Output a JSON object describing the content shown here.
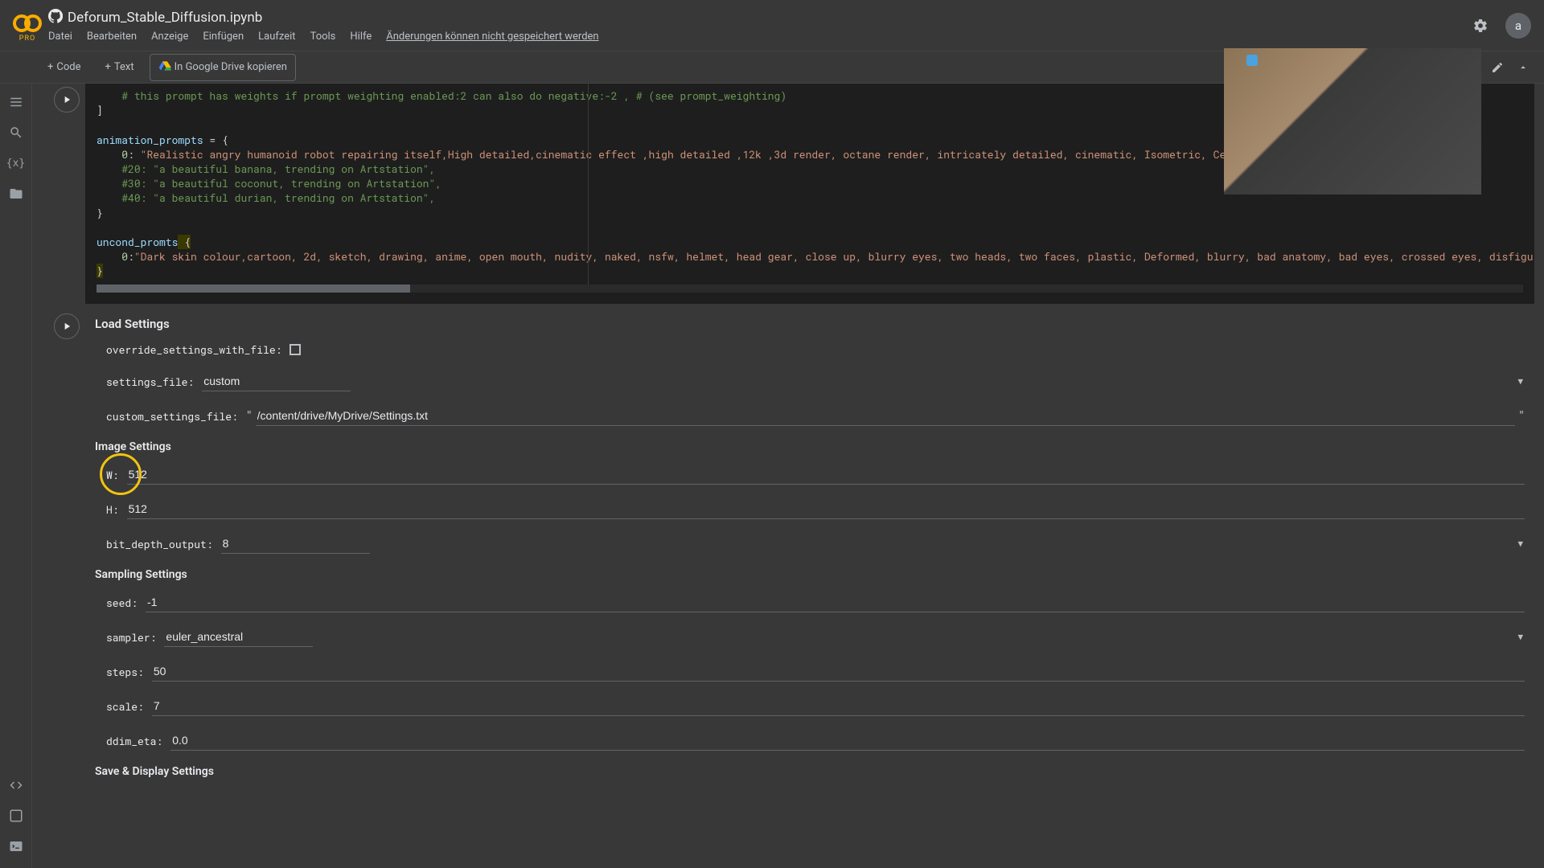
{
  "header": {
    "title": "Deforum_Stable_Diffusion.ipynb",
    "pro": "PRO",
    "menus": [
      "Datei",
      "Bearbeiten",
      "Anzeige",
      "Einfügen",
      "Laufzeit",
      "Tools",
      "Hilfe"
    ],
    "warning": "Änderungen können nicht gespeichert werden",
    "avatar": "a"
  },
  "toolbar": {
    "code": "Code",
    "text": "Text",
    "drive": "In Google Drive kopieren"
  },
  "code": {
    "line1_comment": "# this prompt has weights if prompt weighting enabled:2 can also do negative:-2 , # (see prompt_weighting)",
    "line2_close": "]",
    "anim_var": "animation_prompts",
    "anim_eq": " = {",
    "anim_key0": "0",
    "anim_val0": "\"Realistic angry humanoid robot repairing itself,High detailed,cinematic effect ,high detailed ,12k ,3d render, octane render, intricately detailed, cinematic, Isometric, Centered hipereal full color\"",
    "anim_c20": "#20: \"a beautiful banana, trending on Artstation\",",
    "anim_c30": "#30: \"a beautiful coconut, trending on Artstation\",",
    "anim_c40": "#40: \"a beautiful durian, trending on Artstation\",",
    "anim_close": "}",
    "uncond_var": "uncond_promts",
    "uncond_open": " {",
    "uncond_key0": "0",
    "uncond_val0": "\"Dark skin colour,cartoon, 2d, sketch, drawing, anime, open mouth, nudity, naked, nsfw, helmet, head gear, close up, blurry eyes, two heads, two faces, plastic, Deformed, blurry, bad anatomy, bad eyes, crossed eyes, disfigured,\"",
    "uncond_close": "}"
  },
  "sections": {
    "load": {
      "title": "Load Settings",
      "override_label": "override_settings_with_file:",
      "settings_file_label": "settings_file:",
      "settings_file_value": "custom",
      "custom_file_label": "custom_settings_file:",
      "custom_file_value": "/content/drive/MyDrive/Settings.txt"
    },
    "image": {
      "title": "Image Settings",
      "w_label": "W:",
      "w_value": "512",
      "h_label": "H:",
      "h_value": "512",
      "bitdepth_label": "bit_depth_output:",
      "bitdepth_value": "8"
    },
    "sampling": {
      "title": "Sampling Settings",
      "seed_label": "seed:",
      "seed_value": "-1",
      "sampler_label": "sampler:",
      "sampler_value": "euler_ancestral",
      "steps_label": "steps:",
      "steps_value": "50",
      "scale_label": "scale:",
      "scale_value": "7",
      "ddim_label": "ddim_eta:",
      "ddim_value": "0.0"
    },
    "save": {
      "title": "Save & Display Settings"
    }
  }
}
